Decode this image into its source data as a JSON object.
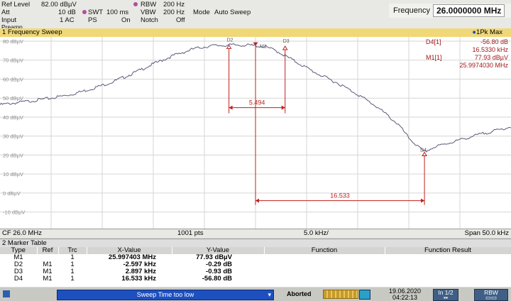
{
  "header": {
    "ref_level_label": "Ref Level",
    "ref_level_value": "82.00 dBµV",
    "att_label": "Att",
    "att_value": "10 dB",
    "input_label": "Input",
    "input_value": "1 AC",
    "preamp": "Preamp",
    "swt_label": "SWT",
    "swt_value": "100 ms",
    "ps_label": "PS",
    "ps_value": "On",
    "rbw_label": "RBW",
    "rbw_value": "200 Hz",
    "vbw_label": "VBW",
    "vbw_value": "200 Hz",
    "notch_label": "Notch",
    "notch_value": "Off",
    "mode_label": "Mode",
    "mode_value": "Auto Sweep",
    "frequency_label": "Frequency",
    "frequency_value": "26.0000000 MHz",
    "accent_color": "#b04fa0"
  },
  "panel": {
    "title": "1 Frequency Sweep",
    "trace_label": "1Pk Max"
  },
  "chart_data": {
    "type": "line",
    "y_tick_labels": [
      "80 dBµV",
      "70 dBµV",
      "60 dBµV",
      "50 dBµV",
      "40 dBµV",
      "30 dBµV",
      "20 dBµV",
      "10 dBµV",
      "0 dBµV",
      "-10 dBµV"
    ],
    "ylim": [
      -12,
      80
    ],
    "xlim_khz": [
      -25,
      25
    ],
    "x": [
      -25,
      -22,
      -20,
      -18,
      -16,
      -14,
      -12,
      -10,
      -8,
      -6,
      -5,
      -4,
      -3,
      -2,
      -1,
      0,
      1,
      2,
      3,
      4,
      5,
      6,
      8,
      10,
      12,
      14,
      15,
      16,
      16.5,
      17,
      18,
      20,
      22,
      24,
      25
    ],
    "y": [
      46.5,
      48.5,
      50,
      52,
      55,
      58.5,
      63,
      68,
      72.5,
      76,
      77,
      77.7,
      77.8,
      78,
      77.9,
      77.6,
      77,
      75,
      72,
      69,
      66,
      63,
      58,
      52,
      45,
      36,
      29,
      24,
      21.5,
      23,
      25,
      28,
      31,
      33.5,
      35
    ],
    "trace_color": "#5a5a7a",
    "marker_line_color": "#c0201c",
    "markers": [
      {
        "name": "M1",
        "x": 0,
        "y": 77.9
      },
      {
        "name": "D2",
        "x": -2.597,
        "y": 77.6
      },
      {
        "name": "D3",
        "x": 2.897,
        "y": 77.0
      },
      {
        "name": "D4",
        "x": 16.533,
        "y": 21.1
      }
    ],
    "delta_labels": [
      {
        "text": "5.494",
        "y": 45
      },
      {
        "text": "16.533",
        "y": -4
      }
    ],
    "readout": [
      {
        "label": "D4[1]",
        "value": "-56.80 dB"
      },
      {
        "label": "",
        "value": "16.5330 kHz"
      },
      {
        "label": "M1[1]",
        "value": "77.93 dBµV"
      },
      {
        "label": "",
        "value": "25.9974030 MHz"
      }
    ]
  },
  "xaxis": {
    "cf": "CF 26.0 MHz",
    "pts": "1001 pts",
    "div": "5.0 kHz/",
    "span": "Span 50.0 kHz"
  },
  "marker_table": {
    "title": "2 Marker Table",
    "columns": [
      "Type",
      "Ref",
      "Trc",
      "X-Value",
      "Y-Value",
      "Function",
      "Function Result"
    ],
    "rows": [
      [
        "M1",
        "",
        "1",
        "25.997403 MHz",
        "77.93 dBµV",
        "",
        ""
      ],
      [
        "D2",
        "M1",
        "1",
        "-2.597 kHz",
        "-0.29 dB",
        "",
        ""
      ],
      [
        "D3",
        "M1",
        "1",
        "2.897 kHz",
        "-0.93 dB",
        "",
        ""
      ],
      [
        "D4",
        "M1",
        "1",
        "16.533 kHz",
        "-56.80 dB",
        "",
        ""
      ]
    ]
  },
  "statusbar": {
    "sweep_message": "Sweep Time too low",
    "state": "Aborted",
    "date": "19.06.2020",
    "time": "04:22:13",
    "page": "In 1/2",
    "mode": "RBW"
  }
}
